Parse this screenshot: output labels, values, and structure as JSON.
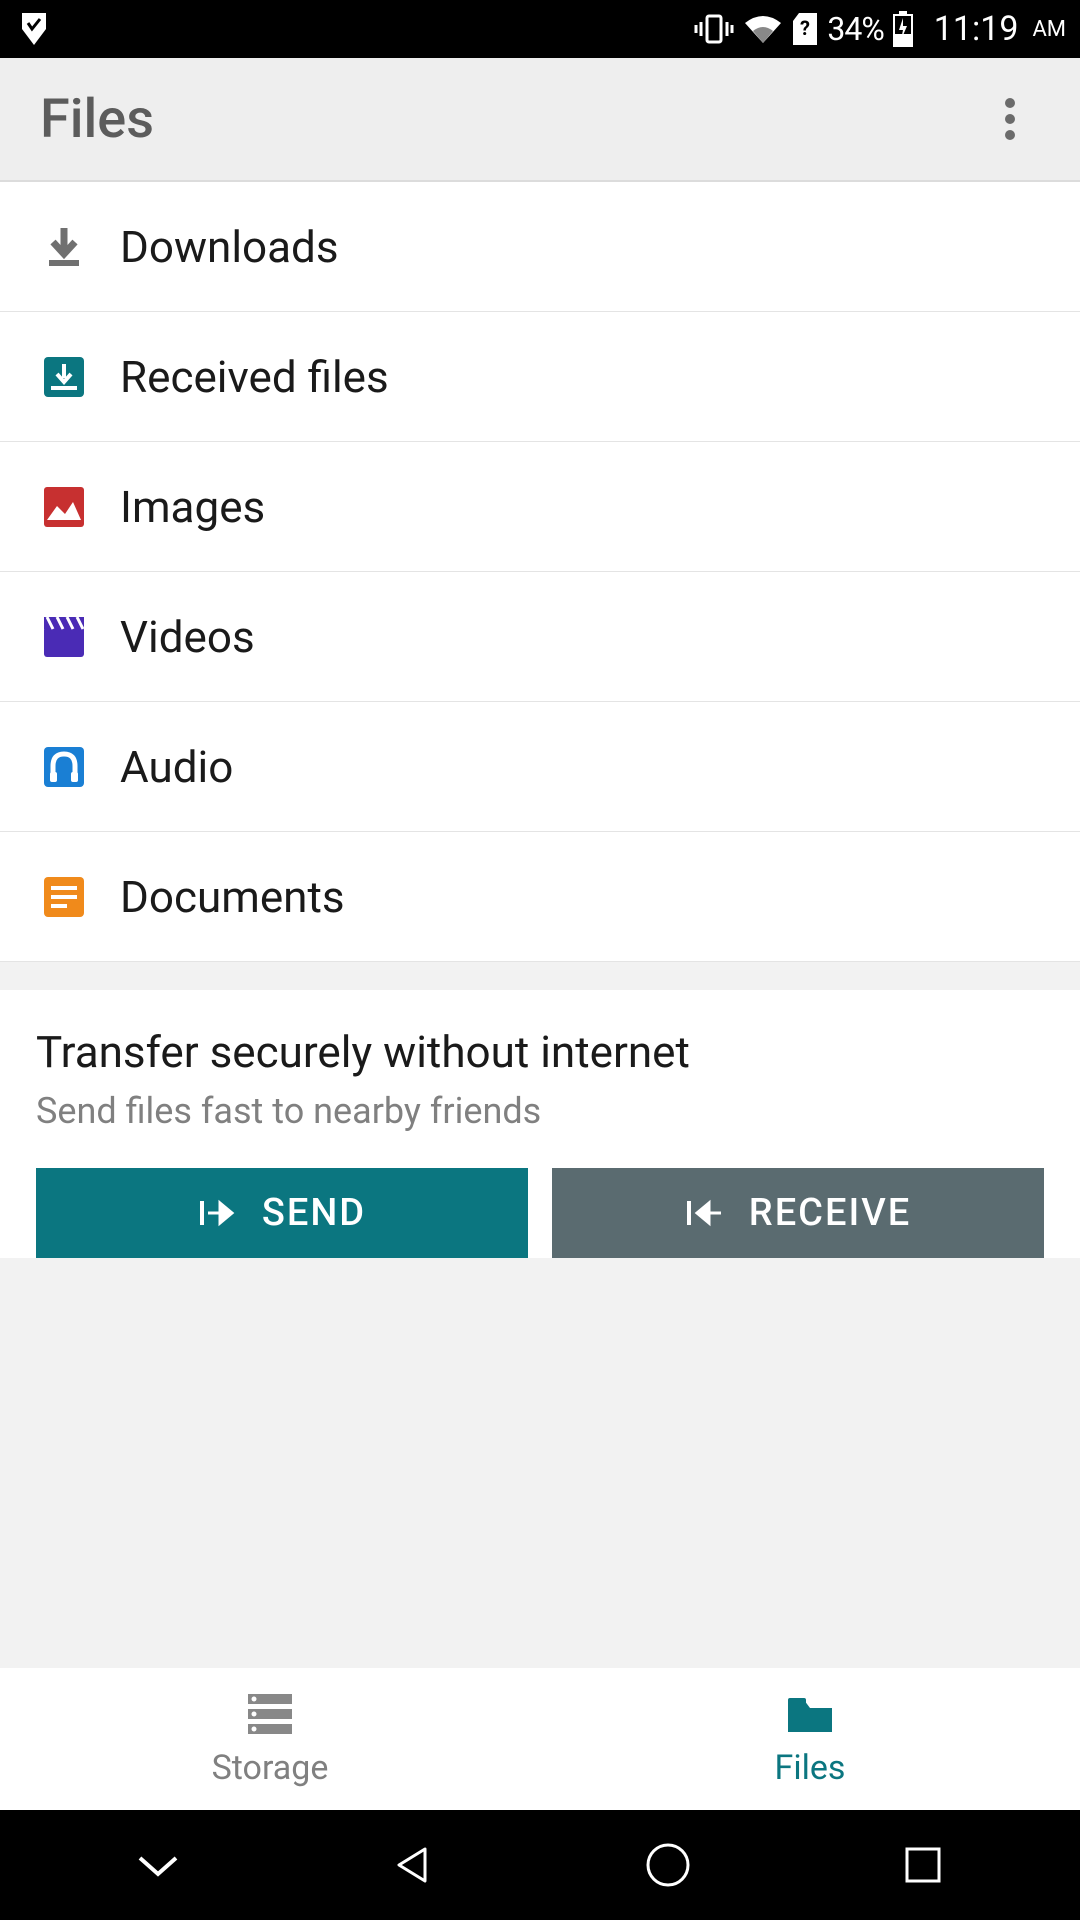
{
  "status": {
    "battery_pct": "34%",
    "time": "11:19",
    "ampm": "AM"
  },
  "appbar": {
    "title": "Files"
  },
  "categories": [
    {
      "label": "Downloads"
    },
    {
      "label": "Received files"
    },
    {
      "label": "Images"
    },
    {
      "label": "Videos"
    },
    {
      "label": "Audio"
    },
    {
      "label": "Documents"
    }
  ],
  "transfer": {
    "title": "Transfer securely without internet",
    "subtitle": "Send files fast to nearby friends",
    "send_label": "SEND",
    "receive_label": "RECEIVE"
  },
  "tabs": {
    "storage": "Storage",
    "files": "Files"
  }
}
